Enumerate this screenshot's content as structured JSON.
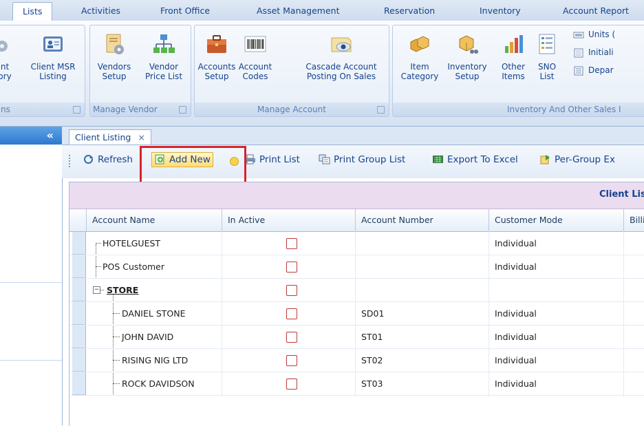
{
  "ribbon_tabs": [
    {
      "label": "Lists",
      "active": true
    },
    {
      "label": "Activities"
    },
    {
      "label": "Front Office"
    },
    {
      "label": "Asset Management"
    },
    {
      "label": "Reservation"
    },
    {
      "label": "Inventory"
    },
    {
      "label": "Account Report"
    }
  ],
  "ribbon": {
    "group_clients": {
      "caption": "ns",
      "buttons": [
        {
          "label_line1": "nt",
          "label_line2": "ory"
        },
        {
          "label_line1": "Client MSR",
          "label_line2": "Listing"
        }
      ]
    },
    "group_vendor": {
      "caption": "Manage Vendor",
      "buttons": [
        {
          "label_line1": "Vendors",
          "label_line2": "Setup"
        },
        {
          "label_line1": "Vendor",
          "label_line2": "Price List"
        }
      ]
    },
    "group_account": {
      "caption": "Manage Account",
      "buttons": [
        {
          "label_line1": "Accounts",
          "label_line2": "Setup"
        },
        {
          "label_line1": "Account",
          "label_line2": "Codes"
        },
        {
          "label_line1": "Cascade Account",
          "label_line2": "Posting On Sales"
        }
      ]
    },
    "group_inventory": {
      "caption": "Inventory And Other Sales I",
      "buttons": [
        {
          "label_line1": "Item",
          "label_line2": "Category"
        },
        {
          "label_line1": "Inventory",
          "label_line2": "Setup"
        },
        {
          "label_line1": "Other",
          "label_line2": "Items"
        },
        {
          "label_line1": "SNO",
          "label_line2": "List"
        }
      ],
      "small_items": [
        "Units (",
        "Initiali",
        "Depar"
      ]
    }
  },
  "left_panel": {
    "collapse_glyph": "«"
  },
  "document_tab": {
    "label": "Client Listing",
    "close": "×"
  },
  "toolbar": {
    "refresh": "Refresh",
    "add_new": "Add New",
    "print_list": "Print List",
    "print_group_list": "Print Group List",
    "export_excel": "Export To Excel",
    "per_group": "Per-Group Ex"
  },
  "grid": {
    "group_title": "Client Lis",
    "columns": [
      "Account Name",
      "In Active",
      "Account Number",
      "Customer Mode",
      "Billi"
    ],
    "rows": [
      {
        "name": "HOTELGUEST",
        "account_number": "",
        "mode": "Individual",
        "level": 0
      },
      {
        "name": "POS Customer",
        "account_number": "",
        "mode": "Individual",
        "level": 0
      },
      {
        "name": "STORE",
        "account_number": "",
        "mode": "",
        "level": 0,
        "expander": "−"
      },
      {
        "name": "DANIEL STONE",
        "account_number": "SD01",
        "mode": "Individual",
        "level": 1
      },
      {
        "name": "JOHN DAVID",
        "account_number": "ST01",
        "mode": "Individual",
        "level": 1
      },
      {
        "name": "RISING NIG LTD",
        "account_number": "ST02",
        "mode": "Individual",
        "level": 1
      },
      {
        "name": "ROCK DAVIDSON",
        "account_number": "ST03",
        "mode": "Individual",
        "level": 1
      }
    ]
  },
  "colors": {
    "highlight_border": "#d8232a",
    "group_row_bg": "#ecdcf0",
    "panel_header": "#2d79d0"
  }
}
